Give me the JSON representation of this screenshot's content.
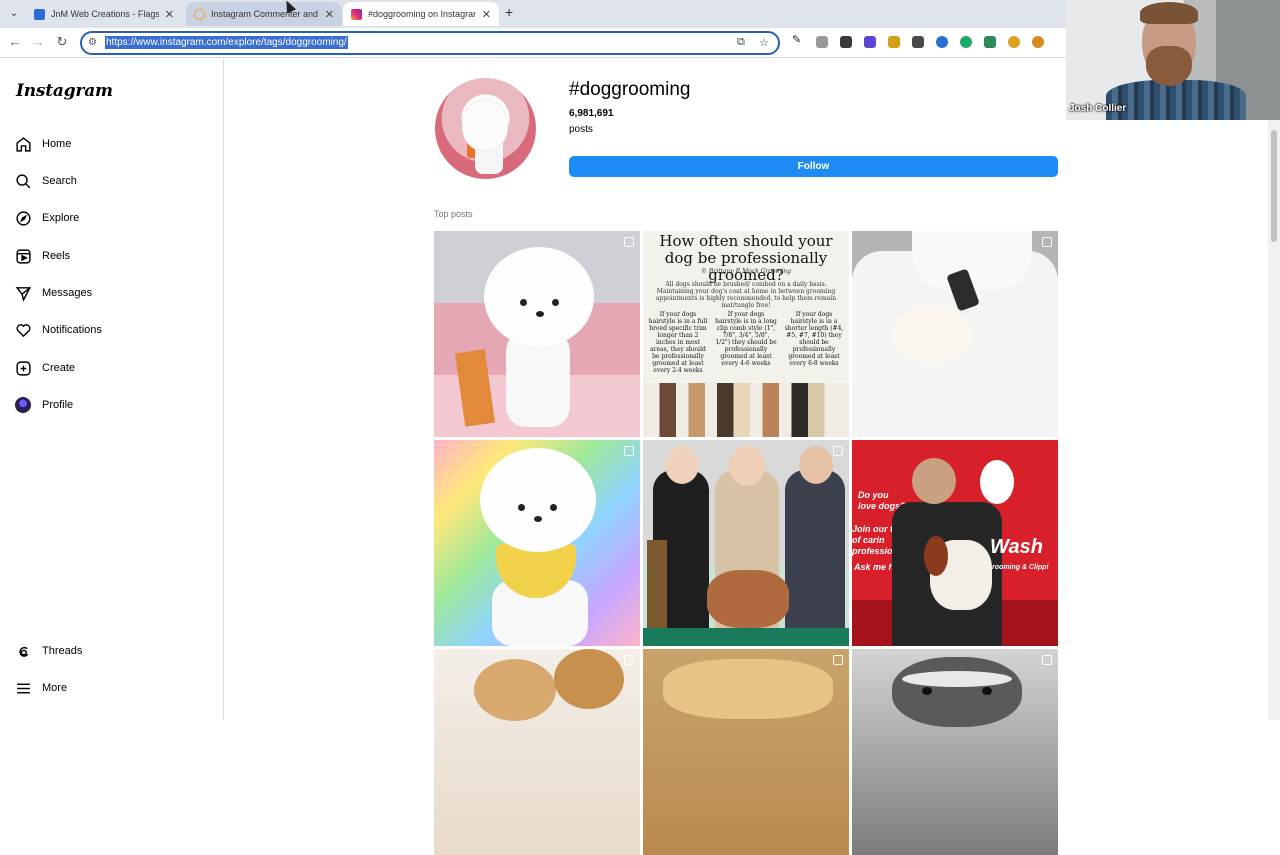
{
  "browser": {
    "tabs": [
      {
        "title": "JnM Web Creations - Flagstaff",
        "favicon_color": "#2c6cd8"
      },
      {
        "title": "Instagram Commenter and DM",
        "favicon_color": "#f5a623"
      },
      {
        "title": "#doggrooming on Instagram",
        "favicon_color": "#dd2a7b"
      }
    ],
    "url": "https://www.instagram.com/explore/tags/doggrooming/",
    "extension_colors": [
      "#222",
      "#888",
      "#3a3a3a",
      "#5b46d6",
      "#4a4a4a",
      "#d4a017",
      "#2a6fd6",
      "#1faa6a",
      "#2e8b57",
      "#e0a020",
      "#d98b1f"
    ]
  },
  "sidebar": {
    "logo": "Instagram",
    "items": [
      {
        "label": "Home",
        "icon": "home-icon"
      },
      {
        "label": "Search",
        "icon": "search-icon"
      },
      {
        "label": "Explore",
        "icon": "compass-icon"
      },
      {
        "label": "Reels",
        "icon": "reels-icon"
      },
      {
        "label": "Messages",
        "icon": "send-icon"
      },
      {
        "label": "Notifications",
        "icon": "heart-icon"
      },
      {
        "label": "Create",
        "icon": "plus-square-icon"
      },
      {
        "label": "Profile",
        "icon": "avatar-icon"
      }
    ],
    "bottom_items": [
      {
        "label": "Threads",
        "icon": "threads-icon"
      },
      {
        "label": "More",
        "icon": "menu-icon"
      }
    ]
  },
  "tag": {
    "title": "#doggrooming",
    "post_count": "6,981,691",
    "post_count_label": "posts",
    "follow_label": "Follow",
    "follow_color": "#1f8cf5"
  },
  "top_posts": {
    "label": "Top posts",
    "tile2": {
      "heading": "How often should your dog be professionally groomed?",
      "byline": "© Brittany R Mock Grooming",
      "intro": "All dogs should be brushed/ combed on a daily basis. Maintaining your dog's coat at home in between grooming appointments is highly recommended, to help them remain mat/tangle free!",
      "col1": "If your dogs hairstyle is in a full breed specific trim longer than 2 inches in most areas, they should be professionally groomed at least every 2-4 weeks",
      "col2": "If your dogs hairstyle is in a long clip comb style (1\", 7/8\", 3/4\", 5/8\", 1/2\") they should be professionally groomed at least every 4-6 weeks",
      "col3": "If your dogs hairstyle is in a shorter length (#4, #5, #7, #10) they should be professionally groomed at least every 6-8 weeks"
    },
    "tile6": {
      "line1": "Do you",
      "line2": "love dogs?",
      "line3": "Join our te",
      "line4": "of carin",
      "line5": "professio",
      "line6": "Ask me h",
      "brand": "Wash",
      "tagline": "rooming & Clippi"
    }
  },
  "webcam": {
    "name": "Josh Collier"
  }
}
